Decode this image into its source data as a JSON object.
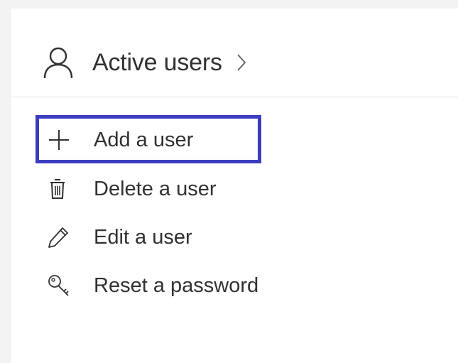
{
  "header": {
    "title": "Active users",
    "icon": "person-icon",
    "chevron": "chevron-right-icon"
  },
  "actions": [
    {
      "label": "Add a user",
      "icon": "plus-icon",
      "highlighted": true
    },
    {
      "label": "Delete a user",
      "icon": "trash-icon",
      "highlighted": false
    },
    {
      "label": "Edit a user",
      "icon": "pencil-icon",
      "highlighted": false
    },
    {
      "label": "Reset a password",
      "icon": "key-icon",
      "highlighted": false
    }
  ],
  "colors": {
    "text": "#323130",
    "highlight": "#3b3dbf",
    "divider": "#e1e1e1",
    "background": "#f3f3f3",
    "card": "#ffffff"
  }
}
